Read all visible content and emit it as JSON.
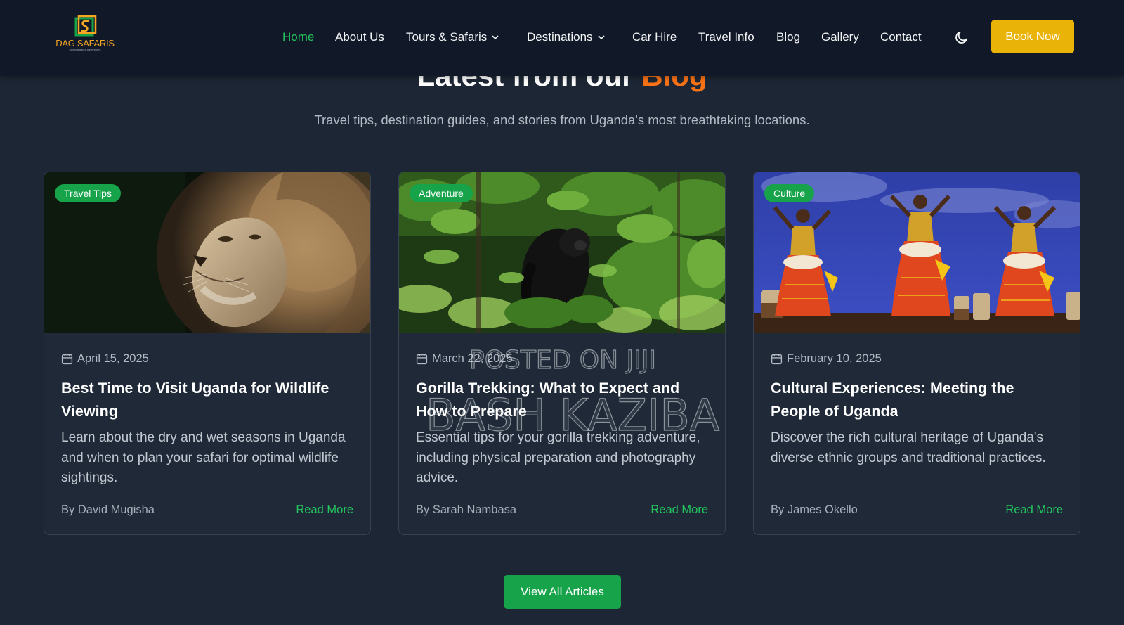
{
  "brand": {
    "logo_text_1": "DAG",
    "logo_text_2": "SAFARIS",
    "logo_tagline": "Unforgettable adventures"
  },
  "nav": {
    "items": [
      {
        "label": "Home",
        "active": true
      },
      {
        "label": "About Us"
      },
      {
        "label": "Tours & Safaris",
        "dropdown": true
      },
      {
        "label": "Destinations",
        "dropdown": true
      },
      {
        "label": "Car Hire"
      },
      {
        "label": "Travel Info"
      },
      {
        "label": "Blog"
      },
      {
        "label": "Gallery"
      },
      {
        "label": "Contact"
      }
    ],
    "theme_icon": "moon-icon",
    "book_label": "Book Now"
  },
  "section": {
    "title_prefix": "Latest from our ",
    "title_accent": "Blog",
    "subtitle": "Travel tips, destination guides, and stories from Uganda's most breathtaking locations."
  },
  "posts": [
    {
      "category": "Travel Tips",
      "date": "April 15, 2025",
      "title": "Best Time to Visit Uganda for Wildlife Viewing",
      "excerpt": "Learn about the dry and wet seasons in Uganda and when to plan your safari for optimal wildlife sightings.",
      "author": "By David Mugisha",
      "read_more": "Read More",
      "image": "lion"
    },
    {
      "category": "Adventure",
      "date": "March 22, 2025",
      "title": "Gorilla Trekking: What to Expect and How to Prepare",
      "excerpt": "Essential tips for your gorilla trekking adventure, including physical preparation and photography advice.",
      "author": "By Sarah Nambasa",
      "read_more": "Read More",
      "image": "gorilla"
    },
    {
      "category": "Culture",
      "date": "February 10, 2025",
      "title": "Cultural Experiences: Meeting the People of Uganda",
      "excerpt": "Discover the rich cultural heritage of Uganda's diverse ethnic groups and traditional practices.",
      "author": "By James Okello",
      "read_more": "Read More",
      "image": "dancers"
    }
  ],
  "view_all_label": "View All Articles",
  "watermark": {
    "line1": "POSTED ON JIJI",
    "line2": "BASH KAZIBA"
  },
  "colors": {
    "accent_green": "#22c55e",
    "accent_orange": "#f97316",
    "accent_yellow": "#eab308",
    "page_bg": "#1d2634",
    "nav_bg": "#111827"
  }
}
